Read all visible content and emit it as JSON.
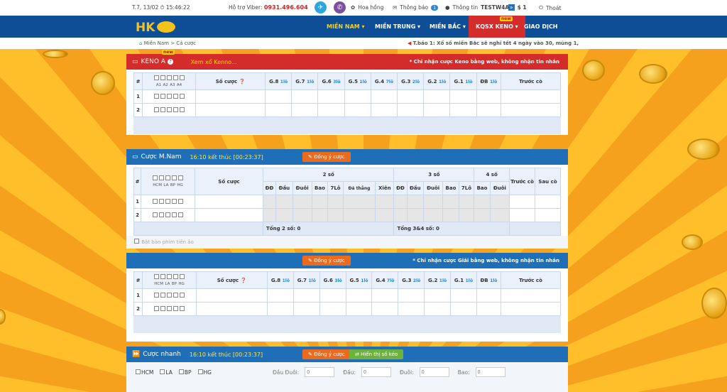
{
  "topbar": {
    "datetime": "T.7, 13/02 ⏱ 15:46:22",
    "support_label": "Hỗ trợ Viber:",
    "support_phone": "0931.496.604",
    "rose": "Hoa hồng",
    "notice": "Thông báo",
    "notice_count": "1",
    "account": "Thông tin",
    "username": "TESTW4A",
    "balance": "$ 1",
    "logout": "Thoát"
  },
  "nav": {
    "logo": "HK",
    "items": [
      "MIỀN NAM",
      "MIỀN TRUNG",
      "MIỀN BẮC",
      "KQSX KENO",
      "GIAO DỊCH"
    ],
    "new": "new"
  },
  "breadcrumb": {
    "path": "Miền Nam > Cá cược",
    "notice": "T.báo 1: Xổ số miền Bắc sẽ nghỉ tết 4 ngày vào 30, mùng 1,"
  },
  "keno": {
    "title": "KENO A",
    "new": "new",
    "link": "Xem xổ Kenno...",
    "note": "* Chỉ nhận cược Keno bằng web, không nhận tin nhắn",
    "cols": [
      "A1",
      "A2",
      "A3",
      "A4"
    ],
    "bet_col": "Số cược",
    "prizes": [
      {
        "n": "G.8",
        "c": "1lô"
      },
      {
        "n": "G.7",
        "c": "1lô"
      },
      {
        "n": "G.6",
        "c": "3lô"
      },
      {
        "n": "G.5",
        "c": "1lô"
      },
      {
        "n": "G.4",
        "c": "7lô"
      },
      {
        "n": "G.3",
        "c": "2lô"
      },
      {
        "n": "G.2",
        "c": "1lô"
      },
      {
        "n": "G.1",
        "c": "1lô"
      },
      {
        "n": "ĐB",
        "c": "1lô"
      }
    ],
    "before": "Trước cò"
  },
  "mnam": {
    "title": "Cược M.Nam",
    "time": "16:10 kết thúc [00:23:37]",
    "agree": "Đồng ý cược",
    "cols": [
      "HCM",
      "LA",
      "BP",
      "HG"
    ],
    "bet_col": "Số cược",
    "g2": "2 số",
    "g3": "3 số",
    "g4": "4 số",
    "sub2": [
      "ĐĐ",
      "Đầu",
      "Đuôi",
      "Bao",
      "7Lô",
      "Đá thẳng",
      "Xiên"
    ],
    "sub3": [
      "ĐĐ",
      "Đầu",
      "Đuôi",
      "Bao",
      "7Lô"
    ],
    "sub4": [
      "Bao",
      "Đuôi"
    ],
    "before": "Trước cò",
    "after": "Sau cò",
    "total2": "Tổng 2 số: 0",
    "total34": "Tổng 3&4 số: 0",
    "vkb": "Bật bàn phím tiền ảo"
  },
  "giai": {
    "agree": "Đồng ý cược",
    "note": "* Chỉ nhận cược Giải bằng web, không nhận tin nhắn",
    "cols": [
      "HCM",
      "LA",
      "BP",
      "HG"
    ],
    "bet_col": "Số cược",
    "before": "Trước cò"
  },
  "quick": {
    "title": "Cược nhanh",
    "time": "16:10 kết thúc [00:23:37]",
    "agree": "Đồng ý cược",
    "show": "Hiển thị số kéo",
    "regions": [
      "HCM",
      "LA",
      "BP",
      "HG"
    ],
    "f1": "Đầu Đuôi:",
    "f2": "Đầu:",
    "f3": "Đuôi:",
    "f4": "Bao:",
    "v": "0"
  }
}
